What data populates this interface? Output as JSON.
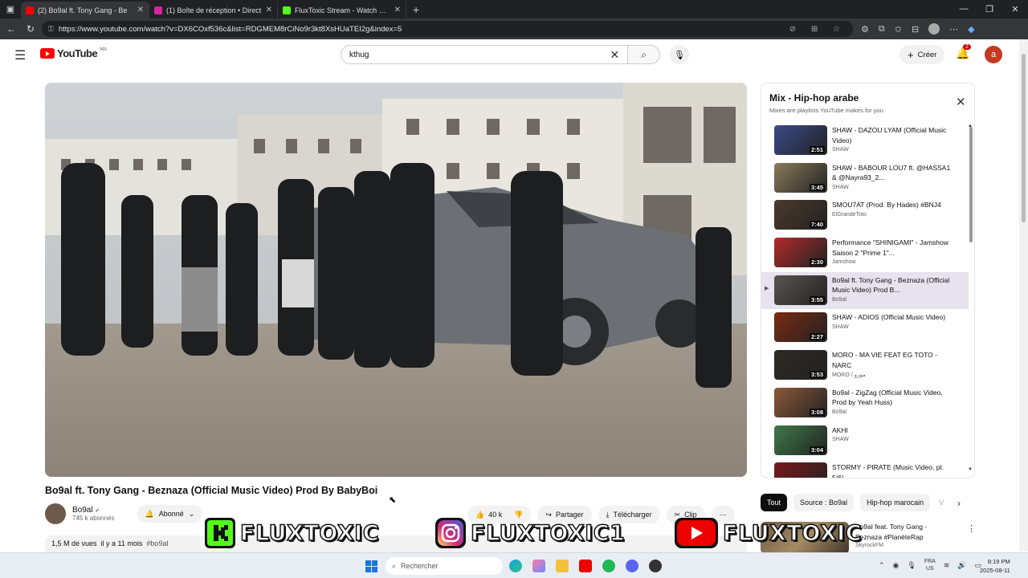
{
  "browser": {
    "tabs": [
      {
        "label": "(2) Bo9al ft. Tony Gang - Be",
        "color": "#ff0000",
        "active": true
      },
      {
        "label": "(1) Boîte de réception • Direct",
        "color": "#d6249f",
        "active": false
      },
      {
        "label": "FluxToxic Stream - Watch Live on",
        "color": "#53fc18",
        "active": false
      }
    ],
    "url": "https://www.youtube.com/watch?v=DX6COxf536c&list=RDGMEM8rCiNo9r3kt8XsHUaTEI2g&index=5"
  },
  "header": {
    "logo_text": "YouTube",
    "country_code": "MA",
    "search_value": "kthug",
    "create_label": "Créer",
    "notif_count": "2",
    "avatar_letter": "a"
  },
  "video": {
    "title": "Bo9al ft. Tony Gang - Beznaza (Official Music Video) Prod By BabyBoi",
    "channel": "Bo9al",
    "subscribers": "745 k abonnés",
    "subscribe_label": "Abonné",
    "likes": "40 k",
    "share_label": "Partager",
    "download_label": "Télécharger",
    "clip_label": "Clip",
    "views": "1,5 M de vues",
    "age": "il y a 11 mois",
    "hashtag": "#bo9al"
  },
  "playlist": {
    "title": "Mix - Hip-hop arabe",
    "subtitle": "Mixes are playlists YouTube makes for you",
    "items": [
      {
        "title": "SHAW - DAZOU LYAM (Official Music Video)",
        "channel": "SHAW",
        "duration": "2:51",
        "color": "#3b4a8a"
      },
      {
        "title": "SHAW - BABOUR LOU7 ft. @HASSA1 & @Nayra93_2...",
        "channel": "SHAW",
        "duration": "3:45",
        "color": "#8a7c5a"
      },
      {
        "title": "SMOU7AT (Prod. By Hades) #BNJ4",
        "channel": "ElGrandeToto",
        "duration": "7:40",
        "color": "#4b3a2e"
      },
      {
        "title": "Performance \"SHINIGAMI\" - Jamshow Saison 2 \"Prime 1\"...",
        "channel": "Jamshow",
        "duration": "2:30",
        "color": "#b22b2b"
      },
      {
        "title": "Bo9al ft. Tony Gang - Beznaza (Official Music Video) Prod B...",
        "channel": "Bo9al",
        "duration": "3:55",
        "color": "#5a5550"
      },
      {
        "title": "SHAW - ADIOS (Official Music Video)",
        "channel": "SHAW",
        "duration": "2:27",
        "color": "#7a2a12"
      },
      {
        "title": "MORO - MA VIE FEAT EG TOTO - NARC",
        "channel": "MORO / مورو",
        "duration": "3:53",
        "color": "#2e2a24"
      },
      {
        "title": "Bo9al - ZigZag (Official Music Video, Prod by Yeah Huss)",
        "channel": "Bo9al",
        "duration": "3:08",
        "color": "#8e5a3a"
      },
      {
        "title": "AKHI",
        "channel": "SHAW",
        "duration": "3:04",
        "color": "#3f7a4a"
      },
      {
        "title": "STORMY - PIRATE (Music Video, pt. 5/6)",
        "channel": "",
        "duration": "",
        "color": "#7a1a1a"
      }
    ]
  },
  "chips": [
    "Tout",
    "Source : Bo9al",
    "Hip-hop marocain",
    "V"
  ],
  "recommendation": {
    "title": "Bo9al feat. Tony Gang - Beznaza #PlanèteRap",
    "channel": "SkyrockFM"
  },
  "overlay": {
    "kick_name": "FLUXTOXIC",
    "instagram_name": "FLUXTOXIC1",
    "youtube_name": "FLUXTOXIC"
  },
  "taskbar": {
    "search_placeholder": "Rechercher",
    "lang_top": "FRA",
    "lang_bottom": "US",
    "time": "8:19 PM",
    "date": "2025-08-11"
  }
}
